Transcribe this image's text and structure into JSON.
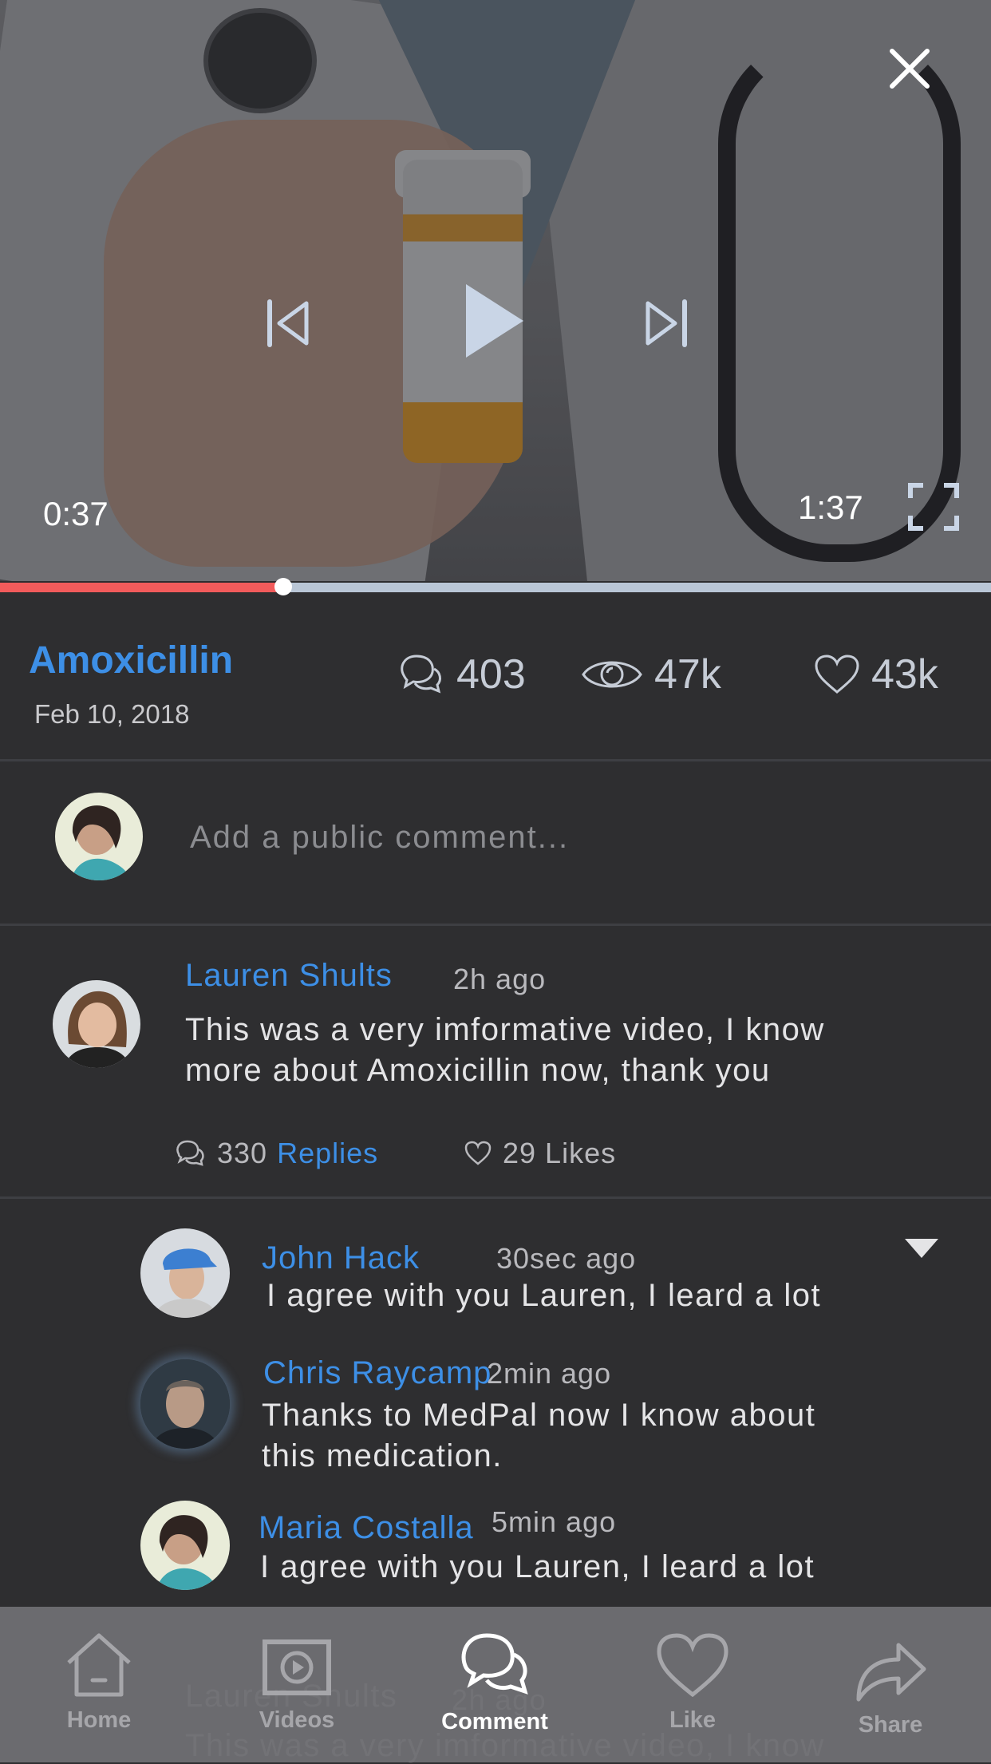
{
  "player": {
    "time_current": "0:37",
    "time_total": "1:37",
    "progress": 0.286,
    "icons": {
      "close": "close-icon",
      "prev": "skip-previous-icon",
      "play": "play-icon",
      "next": "skip-next-icon",
      "fullscreen": "fullscreen-icon"
    }
  },
  "video": {
    "title": "Amoxicillin",
    "date": "Feb 10, 2018",
    "stats": {
      "comments": "403",
      "views": "47k",
      "likes": "43k"
    }
  },
  "comment_box": {
    "placeholder": "Add a public comment..."
  },
  "comments": [
    {
      "user": "Lauren Shults",
      "time": "2h ago",
      "text_line1": "This was a very imformative video, I know",
      "text_line2": "more about Amoxicillin now, thank you",
      "replies_count": "330",
      "replies_label": "Replies",
      "likes": "29 Likes"
    }
  ],
  "replies": [
    {
      "user": "John Hack",
      "time": "30sec ago",
      "text_line1": "I agree with you Lauren, I leard a lot"
    },
    {
      "user": "Chris Raycamp",
      "time": "2min ago",
      "text_line1": "Thanks to MedPal now I know about",
      "text_line2": "this medication."
    },
    {
      "user": "Maria Costalla",
      "time": "5min ago",
      "text_line1": "I agree with you Lauren, I leard a lot"
    }
  ],
  "behind_nav": {
    "user": "Lauren Shults",
    "time": "2h ago",
    "text": "This was a very imformative video, I know"
  },
  "nav": [
    {
      "label": "Home",
      "icon": "home-icon"
    },
    {
      "label": "Videos",
      "icon": "video-icon"
    },
    {
      "label": "Comment",
      "icon": "comment-icon",
      "active": true
    },
    {
      "label": "Like",
      "icon": "heart-icon"
    },
    {
      "label": "Share",
      "icon": "share-icon"
    }
  ],
  "colors": {
    "accent": "#3d8fe6",
    "progress": "#f25b5b",
    "background": "#2e2e30"
  }
}
